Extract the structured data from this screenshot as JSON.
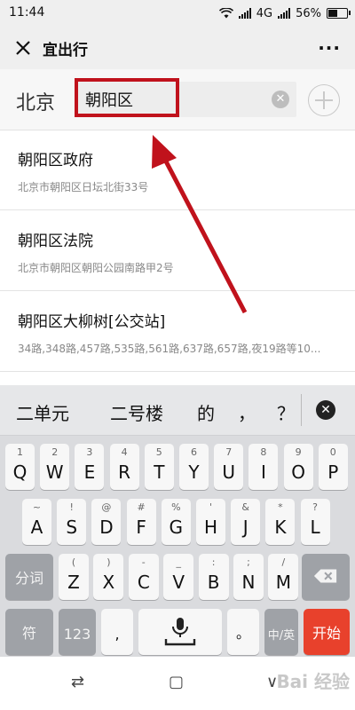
{
  "status": {
    "time": "11:44",
    "network": "4G",
    "battery": "56%",
    "battery_level": 0.56
  },
  "titlebar": {
    "title": "宜出行",
    "more": "···"
  },
  "search": {
    "city": "北京",
    "value": "朝阳区",
    "clear_icon": "clear-icon"
  },
  "results": [
    {
      "name": "朝阳区政府",
      "address": "北京市朝阳区日坛北街33号"
    },
    {
      "name": "朝阳区法院",
      "address": "北京市朝阳区朝阳公园南路甲2号"
    },
    {
      "name": "朝阳区大柳树[公交站]",
      "address": "34路,348路,457路,535路,561路,637路,657路,夜19路等10..."
    }
  ],
  "keyboard": {
    "candidates": [
      "二单元",
      "二号楼",
      "的",
      "，",
      "？"
    ],
    "row1": [
      {
        "main": "Q",
        "sub": "1"
      },
      {
        "main": "W",
        "sub": "2"
      },
      {
        "main": "E",
        "sub": "3"
      },
      {
        "main": "R",
        "sub": "4"
      },
      {
        "main": "T",
        "sub": "5"
      },
      {
        "main": "Y",
        "sub": "6"
      },
      {
        "main": "U",
        "sub": "7"
      },
      {
        "main": "I",
        "sub": "8"
      },
      {
        "main": "O",
        "sub": "9"
      },
      {
        "main": "P",
        "sub": "0"
      }
    ],
    "row2": [
      {
        "main": "A",
        "sub": "~"
      },
      {
        "main": "S",
        "sub": "!"
      },
      {
        "main": "D",
        "sub": "@"
      },
      {
        "main": "F",
        "sub": "#"
      },
      {
        "main": "G",
        "sub": "%"
      },
      {
        "main": "H",
        "sub": "'"
      },
      {
        "main": "J",
        "sub": "&"
      },
      {
        "main": "K",
        "sub": "*"
      },
      {
        "main": "L",
        "sub": "?"
      }
    ],
    "row3": [
      {
        "main": "Z",
        "sub": "("
      },
      {
        "main": "X",
        "sub": ")"
      },
      {
        "main": "C",
        "sub": "-"
      },
      {
        "main": "V",
        "sub": "_"
      },
      {
        "main": "B",
        "sub": ":"
      },
      {
        "main": "N",
        "sub": ";"
      },
      {
        "main": "M",
        "sub": "/"
      }
    ],
    "segment_label": "分词",
    "symbol_label": "符",
    "number_label": "123",
    "comma_label": ",",
    "period_label": "。",
    "lang_label": "中/英",
    "go_label": "开始"
  },
  "watermark": "Bai 经验",
  "colors": {
    "highlight": "#c0121c",
    "go_key": "#e8412c"
  }
}
